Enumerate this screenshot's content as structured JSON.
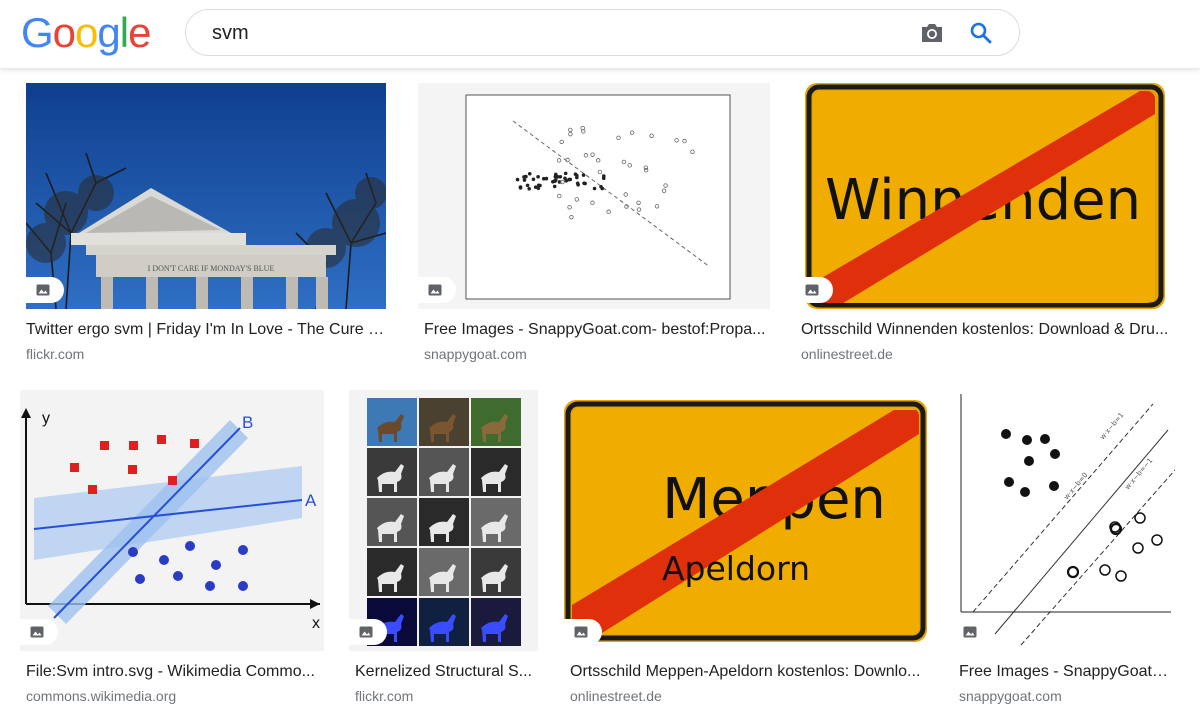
{
  "header": {
    "logo_letters": [
      {
        "ch": "G",
        "color": "#4285F4"
      },
      {
        "ch": "o",
        "color": "#EA4335"
      },
      {
        "ch": "o",
        "color": "#FBBC05"
      },
      {
        "ch": "g",
        "color": "#4285F4"
      },
      {
        "ch": "l",
        "color": "#34A853"
      },
      {
        "ch": "e",
        "color": "#EA4335"
      }
    ],
    "query": "svm",
    "camera_icon": "camera-icon",
    "search_icon": "search-icon"
  },
  "results": [
    {
      "title": "Twitter ergo svm | Friday I'm In Love - The Cure L...",
      "domain": "flickr.com",
      "image": "temple-ruin-photo",
      "inscription": "I DON'T CARE IF MONDAY'S BLUE"
    },
    {
      "title": "Free Images - SnappyGoat.com- bestof:Propa...",
      "domain": "snappygoat.com",
      "image": "scatter-plot"
    },
    {
      "title": "Ortsschild Winnenden kostenlos: Download & Dru...",
      "domain": "onlinestreet.de",
      "image": "town-sign",
      "sign_text": "Winnenden"
    },
    {
      "title": "File:Svm intro.svg - Wikimedia Commo...",
      "domain": "commons.wikimedia.org",
      "image": "svm-diagram",
      "labels": {
        "y": "y",
        "x": "x",
        "a": "A",
        "b": "B"
      }
    },
    {
      "title": "Kernelized Structural S...",
      "domain": "flickr.com",
      "image": "horse-grid"
    },
    {
      "title": "Ortsschild Meppen-Apeldorn kostenlos: Downlo...",
      "domain": "onlinestreet.de",
      "image": "town-sign",
      "sign_text": "Meppen",
      "sign_subtext": "Apeldorn"
    },
    {
      "title": "Free Images - SnappyGoat.com- bestof:Stuck-Pr...",
      "domain": "snappygoat.com",
      "image": "svm-margin-diagram"
    }
  ],
  "colors": {
    "accent": "#1a73e8",
    "sign_yellow": "#f0ad00",
    "sign_red": "#e0300b"
  }
}
